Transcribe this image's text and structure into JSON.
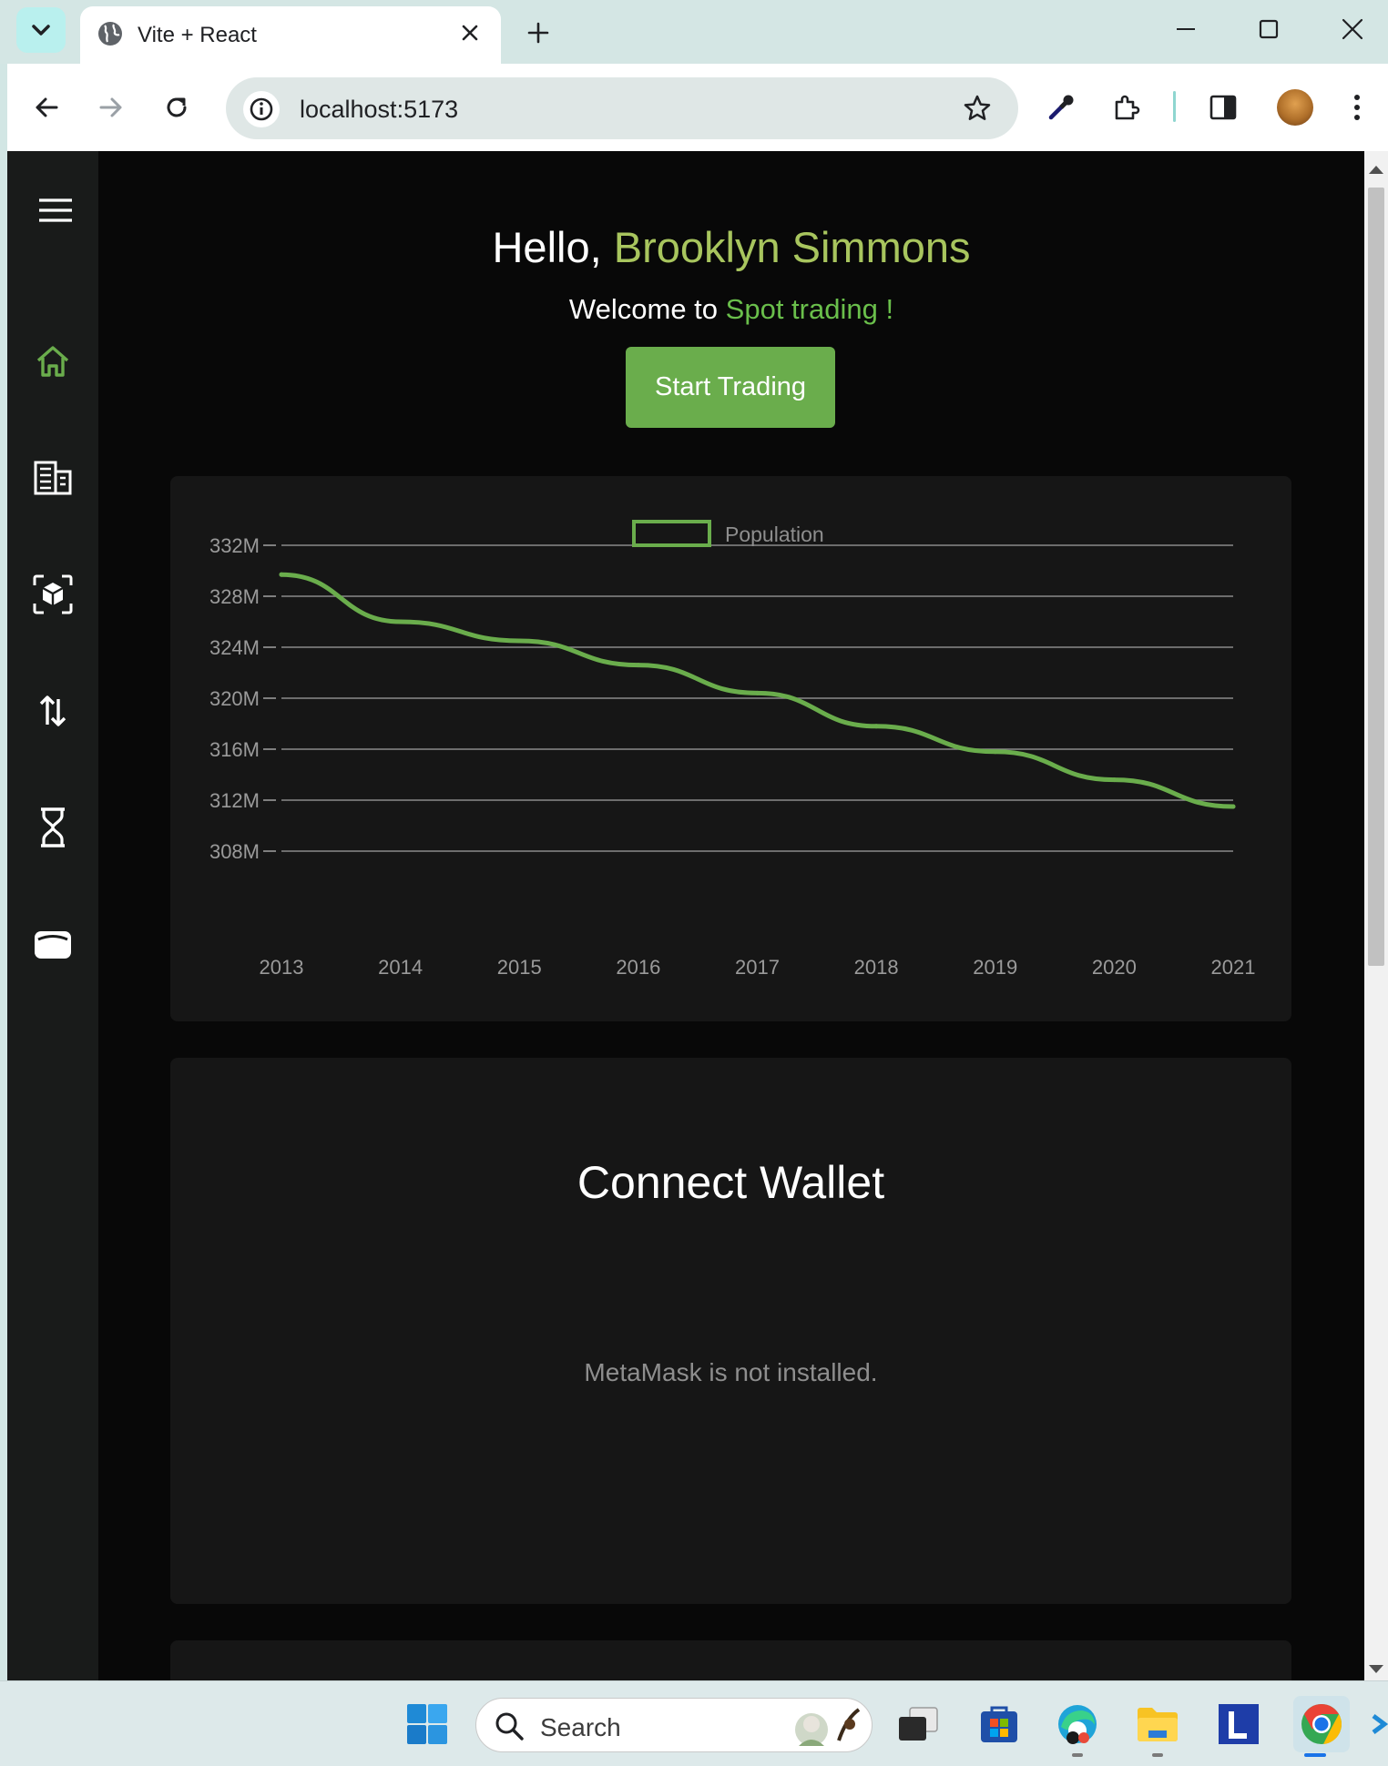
{
  "browser": {
    "tab_title": "Vite + React",
    "url": "localhost:5173"
  },
  "sidebar": {
    "items": [
      {
        "name": "menu-icon"
      },
      {
        "name": "home-icon",
        "active": true
      },
      {
        "name": "building-icon"
      },
      {
        "name": "cube-scan-icon"
      },
      {
        "name": "transfer-arrows-icon"
      },
      {
        "name": "hourglass-icon"
      },
      {
        "name": "wallet-icon"
      }
    ]
  },
  "hero": {
    "greeting": "Hello,",
    "user_name": "Brooklyn Simmons",
    "welcome_prefix": "Welcome to",
    "welcome_highlight": "Spot trading !",
    "cta_label": "Start Trading"
  },
  "chart_data": {
    "type": "line",
    "x": [
      "2013",
      "2014",
      "2015",
      "2016",
      "2017",
      "2018",
      "2019",
      "2020",
      "2021"
    ],
    "series": [
      {
        "name": "Population",
        "values": [
          329.7,
          326.0,
          324.5,
          322.6,
          320.4,
          317.8,
          315.8,
          313.6,
          311.5
        ]
      }
    ],
    "y_ticks": [
      "332M",
      "328M",
      "324M",
      "320M",
      "316M",
      "312M",
      "308M"
    ],
    "ylim": [
      308,
      332
    ],
    "legend": "top-center",
    "grid": true,
    "color": "#6aad4c"
  },
  "wallet": {
    "title": "Connect Wallet",
    "message": "MetaMask is not installed."
  },
  "taskbar": {
    "search_label": "Search"
  },
  "colors": {
    "accent": "#6aad4c",
    "name_accent": "#a8c55e",
    "background": "#080808",
    "card": "#161616",
    "sidebar": "#191b1a"
  }
}
